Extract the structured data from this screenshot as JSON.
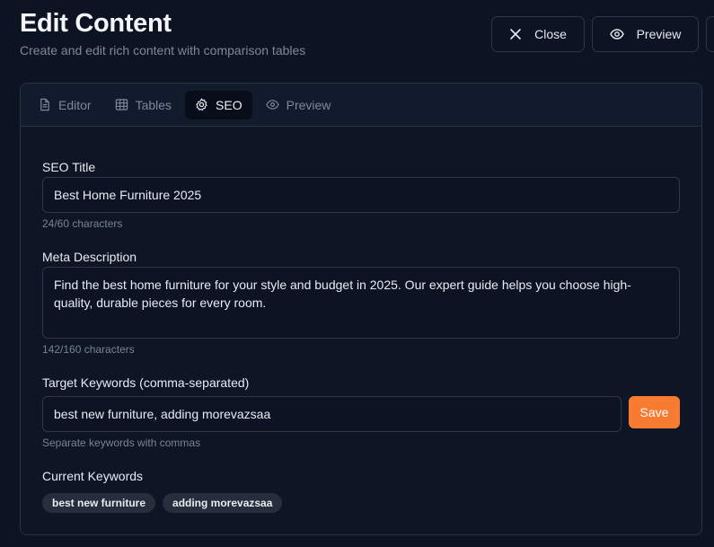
{
  "header": {
    "title": "Edit Content",
    "subtitle": "Create and edit rich content with comparison tables",
    "close_label": "Close",
    "preview_label": "Preview"
  },
  "tabs": [
    {
      "label": "Editor",
      "icon": "document-icon",
      "active": false
    },
    {
      "label": "Tables",
      "icon": "table-icon",
      "active": false
    },
    {
      "label": "SEO",
      "icon": "gear-icon",
      "active": true
    },
    {
      "label": "Preview",
      "icon": "eye-icon",
      "active": false
    }
  ],
  "seo": {
    "title_label": "SEO Title",
    "title_value": "Best Home Furniture 2025",
    "title_count": "24/60 characters",
    "meta_label": "Meta Description",
    "meta_value": "Find the best home furniture for your style and budget in 2025. Our expert guide helps you choose high-quality, durable pieces for every room.",
    "meta_count": "142/160 characters",
    "keywords_label": "Target Keywords (comma-separated)",
    "keywords_value": "best new furniture, adding morevazsaa",
    "save_label": "Save",
    "keywords_hint": "Separate keywords with commas",
    "current_label": "Current Keywords",
    "current_keywords": [
      "best new furniture",
      "adding morevazsaa"
    ]
  },
  "colors": {
    "accent": "#f77b31",
    "background": "#0c1424"
  }
}
